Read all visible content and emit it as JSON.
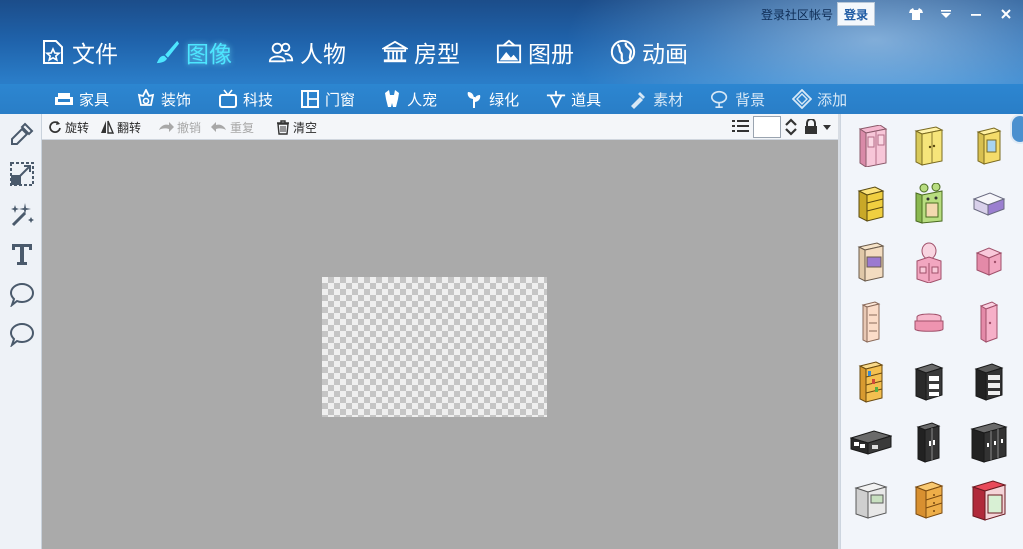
{
  "window": {
    "login_link": "登录社区帐号",
    "login_button": "登录",
    "controls": {
      "skin": "👕",
      "menu": "▾",
      "minimize": "−",
      "close": "✕"
    }
  },
  "main_nav": [
    {
      "label": "文件",
      "icon": "file-icon"
    },
    {
      "label": "图像",
      "icon": "brush-icon",
      "active": true
    },
    {
      "label": "人物",
      "icon": "people-icon"
    },
    {
      "label": "房型",
      "icon": "building-icon"
    },
    {
      "label": "图册",
      "icon": "album-icon"
    },
    {
      "label": "动画",
      "icon": "globe-icon"
    }
  ],
  "sub_nav": [
    {
      "label": "家具",
      "icon": "sofa-icon"
    },
    {
      "label": "装饰",
      "icon": "decoration-icon"
    },
    {
      "label": "科技",
      "icon": "tv-icon"
    },
    {
      "label": "门窗",
      "icon": "door-icon"
    },
    {
      "label": "人宠",
      "icon": "pet-icon"
    },
    {
      "label": "绿化",
      "icon": "plant-icon"
    },
    {
      "label": "道具",
      "icon": "prop-icon"
    },
    {
      "label": "素材",
      "icon": "material-icon",
      "dim": true
    },
    {
      "label": "背景",
      "icon": "background-icon",
      "dim": true
    },
    {
      "label": "添加",
      "icon": "add-icon",
      "dim": true
    }
  ],
  "left_tools": [
    "brush-tool-icon",
    "resize-tool-icon",
    "magic-wand-icon",
    "text-tool-icon",
    "speech-bubble-icon",
    "thought-bubble-icon"
  ],
  "edit_toolbar": {
    "rotate": "旋转",
    "flip": "翻转",
    "undo": "撤销",
    "redo": "重复",
    "clear": "清空",
    "size_value": ""
  },
  "colors": {
    "header_dark": "#1c4d8a",
    "header_light": "#2f86d0",
    "active_nav": "#4de6ff",
    "canvas_bg": "#aaaaaa",
    "panel_bg": "#f2f5fa"
  },
  "catalog_items": [
    "pink-wardrobe",
    "yellow-double-cabinet",
    "yellow-single-cabinet",
    "yellow-drawer-unit",
    "green-frog-cabinet",
    "purple-lid-box",
    "purple-wardrobe",
    "pink-dressing-table",
    "pink-nightstand",
    "pink-tall-cabinet",
    "pink-small-sofa",
    "pink-narrow-cabinet",
    "yellow-bookshelf",
    "black-drawer-cabinet",
    "black-dresser",
    "black-tv-stand",
    "black-wardrobe",
    "black-wide-wardrobe",
    "white-shelf",
    "wooden-drawer-chest",
    "red-canopy-cabinet"
  ]
}
